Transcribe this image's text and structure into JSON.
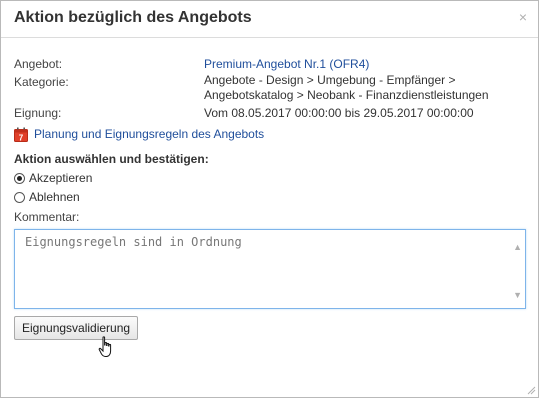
{
  "dialog": {
    "title": "Aktion bezüglich des Angebots",
    "close_icon": "×"
  },
  "details": {
    "offer_label": "Angebot:",
    "offer_value": "Premium-Angebot Nr.1 (OFR4)",
    "category_label": "Kategorie:",
    "category_line1": "Angebote - Design > Umgebung - Empfänger >",
    "category_line2": "Angebotskatalog > Neobank - Finanzdienstleistungen",
    "eligibility_label": "Eignung:",
    "eligibility_value": "Vom 08.05.2017 00:00:00 bis 29.05.2017 00:00:00"
  },
  "planning": {
    "icon": "calendar-icon",
    "link_text": "Planung und Eignungsregeln des Angebots"
  },
  "action": {
    "section_title": "Aktion auswählen und bestätigen:",
    "options": [
      {
        "label": "Akzeptieren",
        "checked": true
      },
      {
        "label": "Ablehnen",
        "checked": false
      }
    ]
  },
  "comment": {
    "label": "Kommentar:",
    "value": "Eignungsregeln sind in Ordnung"
  },
  "buttons": {
    "validate_label": "Eignungsvalidierung"
  },
  "colors": {
    "link": "#1f4e9b",
    "calendar_red": "#e0402a",
    "focus_border": "#7eb4ea"
  }
}
